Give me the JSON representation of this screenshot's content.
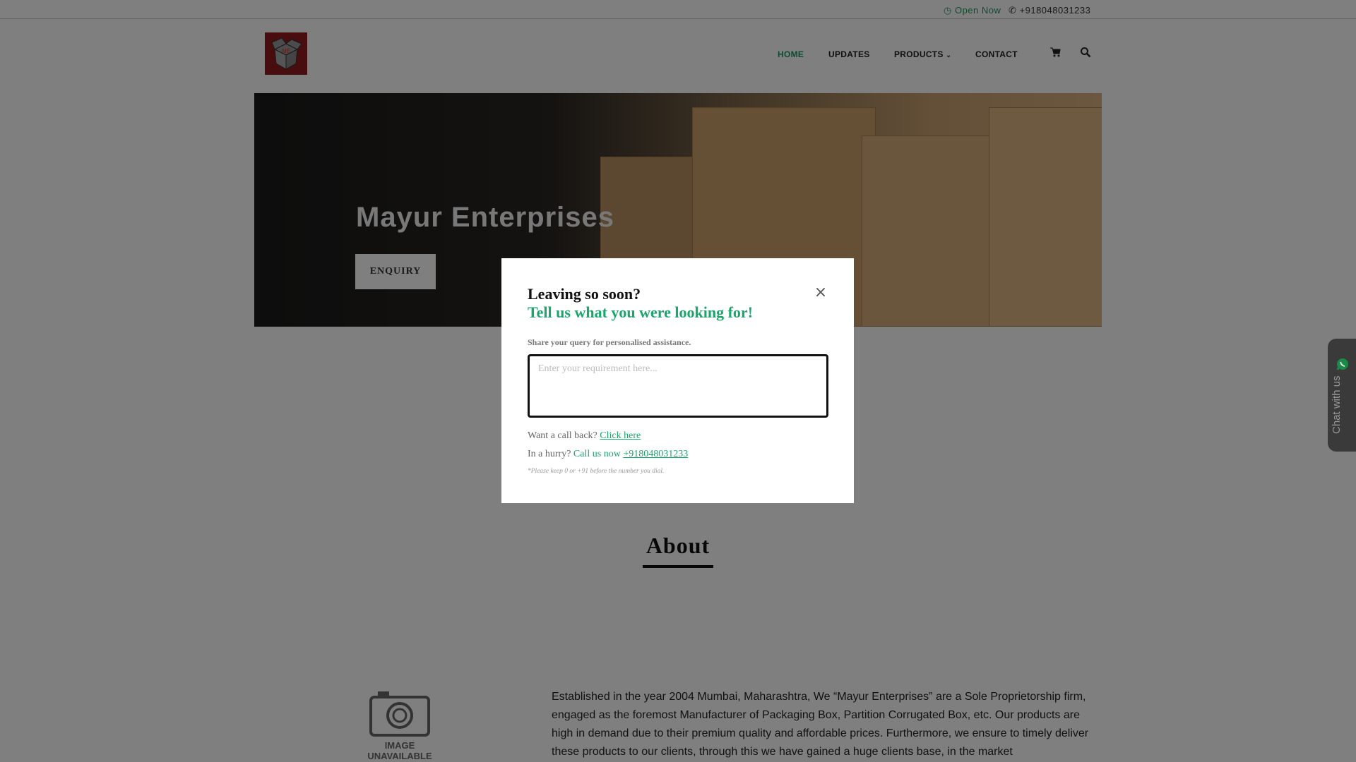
{
  "topbar": {
    "status": "Open Now",
    "phone": "+918048031233"
  },
  "nav": {
    "items": [
      "HOME",
      "UPDATES",
      "PRODUCTS",
      "CONTACT"
    ],
    "products_caret": "⌄"
  },
  "hero": {
    "title": "Mayur Enterprises",
    "button": "ENQUIRY"
  },
  "about": {
    "title": "About",
    "image_placeholder": "IMAGE UNAVAILABLE",
    "text": "Established in the year 2004 Mumbai, Maharashtra, We “Mayur Enterprises” are a Sole Proprietorship firm, engaged as the foremost Manufacturer of Packaging Box, Partition Corrugated Box, etc. Our products are high in demand due to their premium quality and affordable prices. Furthermore, we ensure to timely deliver these products to our clients, through this we have gained a huge clients base, in the market"
  },
  "chat": {
    "label": "Chat with us"
  },
  "modal": {
    "title": "Leaving so soon?",
    "subtitle": "Tell us what you were looking for!",
    "hint": "Share your query for personalised assistance.",
    "placeholder": "Enter your requirement here...",
    "callback_q": "Want a call back?",
    "callback_link": "Click here",
    "hurry_q": "In a hurry?",
    "call_now": "Call us now",
    "phone": "+918048031233",
    "note": "*Please keep 0 or +91 before the number you dial.",
    "close": "×"
  },
  "colors": {
    "accent": "#1aa66a",
    "logo": "#8e1b1f"
  }
}
